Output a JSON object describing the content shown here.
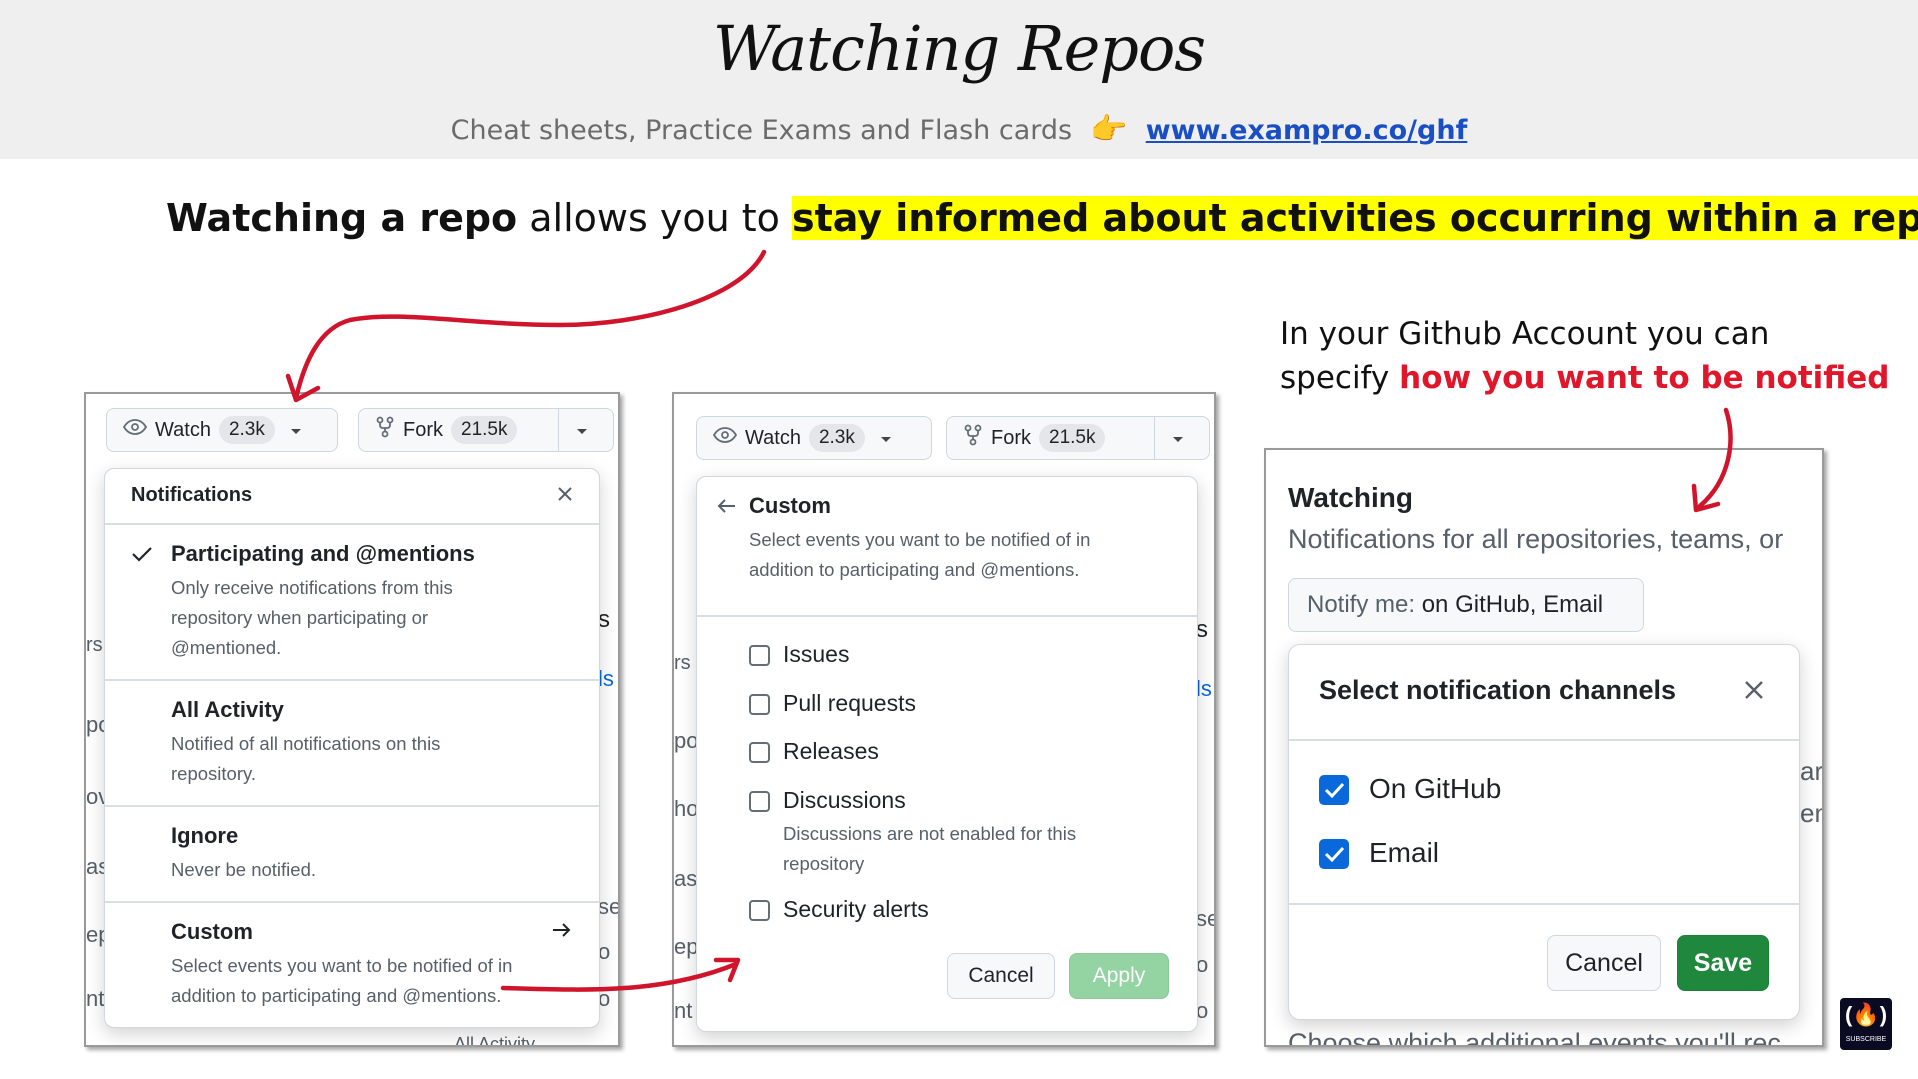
{
  "header": {
    "title": "Watching Repos",
    "subtitle": "Cheat sheets, Practice Exams and Flash cards",
    "link": "www.exampro.co/ghf"
  },
  "headline": {
    "bold": "Watching a repo",
    "normal": " allows you to ",
    "highlight": "stay informed about activities occurring within a repo",
    "end": "."
  },
  "note": {
    "line1": "In your Github Account you can",
    "line2_prefix": "specify ",
    "line2_red": "how you want to be notified"
  },
  "panel1": {
    "watch_label": "Watch",
    "watch_count": "2.3k",
    "fork_label": "Fork",
    "fork_count": "21.5k",
    "popup_title": "Notifications",
    "items": [
      {
        "title": "Participating and @mentions",
        "desc": [
          "Only receive notifications from this",
          "repository when participating or",
          "@mentioned."
        ]
      },
      {
        "title": "All Activity",
        "desc": [
          "Notified of all notifications on this",
          "repository."
        ]
      },
      {
        "title": "Ignore",
        "desc": [
          "Never be notified."
        ]
      },
      {
        "title": "Custom",
        "desc": [
          "Select events you want to be notified of in",
          "addition to participating and @mentions."
        ]
      }
    ],
    "bg_bottom": "All Activity"
  },
  "panel2": {
    "watch_label": "Watch",
    "watch_count": "2.3k",
    "fork_label": "Fork",
    "fork_count": "21.5k",
    "popup_title": "Custom",
    "popup_desc": [
      "Select events you want to be notified of in",
      "addition to participating and @mentions."
    ],
    "options": [
      {
        "label": "Issues"
      },
      {
        "label": "Pull requests"
      },
      {
        "label": "Releases"
      },
      {
        "label": "Discussions",
        "note": [
          "Discussions are not enabled for this",
          "repository"
        ]
      },
      {
        "label": "Security alerts"
      }
    ],
    "cancel": "Cancel",
    "apply": "Apply"
  },
  "panel3": {
    "heading": "Watching",
    "desc": "Notifications for all repositories, teams, or",
    "notify_prefix": "Notify me:",
    "notify_value": "on GitHub, Email",
    "dialog_title": "Select notification channels",
    "channels": [
      {
        "label": "On GitHub",
        "checked": true
      },
      {
        "label": "Email",
        "checked": true
      }
    ],
    "cancel": "Cancel",
    "save": "Save",
    "bg_bottom": "Choose which additional events you'll rec"
  },
  "badge": "SUBSCRIBE",
  "colors": {
    "highlight": "#ffff00",
    "red_accent": "#e0162b",
    "arrow": "#d0142c",
    "save_green": "#1f883d",
    "apply_green": "#94d3a2",
    "checkbox_blue": "#0969da",
    "link_blue": "#1a4fc4"
  }
}
